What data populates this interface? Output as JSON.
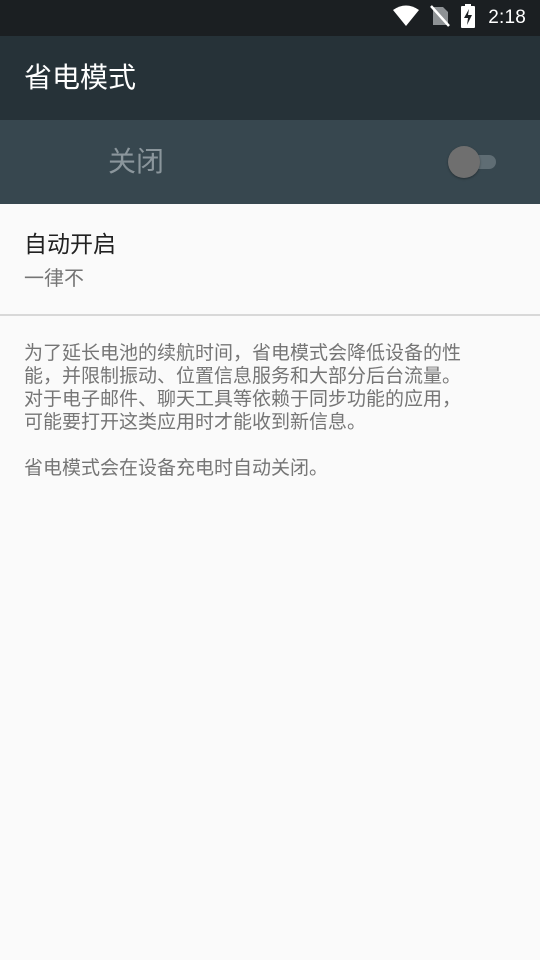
{
  "status_bar": {
    "time": "2:18",
    "icons": [
      "wifi-icon",
      "no-sim-icon",
      "battery-charging-icon"
    ]
  },
  "app_bar": {
    "title": "省电模式"
  },
  "master_switch": {
    "label": "关闭",
    "enabled": false
  },
  "auto_enable": {
    "title": "自动开启",
    "summary": "一律不"
  },
  "description": {
    "paragraph1": "为了延长电池的续航时间，省电模式会降低设备的性\n能，并限制振动、位置信息服务和大部分后台流量。\n对于电子邮件、聊天工具等依赖于同步功能的应用，\n可能要打开这类应用时才能收到新信息。",
    "paragraph2": "省电模式会在设备充电时自动关闭。"
  },
  "colors": {
    "status_bar": "#1b1f22",
    "app_bar": "#263238",
    "switch_bar": "#37474f",
    "background": "#fafafa"
  }
}
